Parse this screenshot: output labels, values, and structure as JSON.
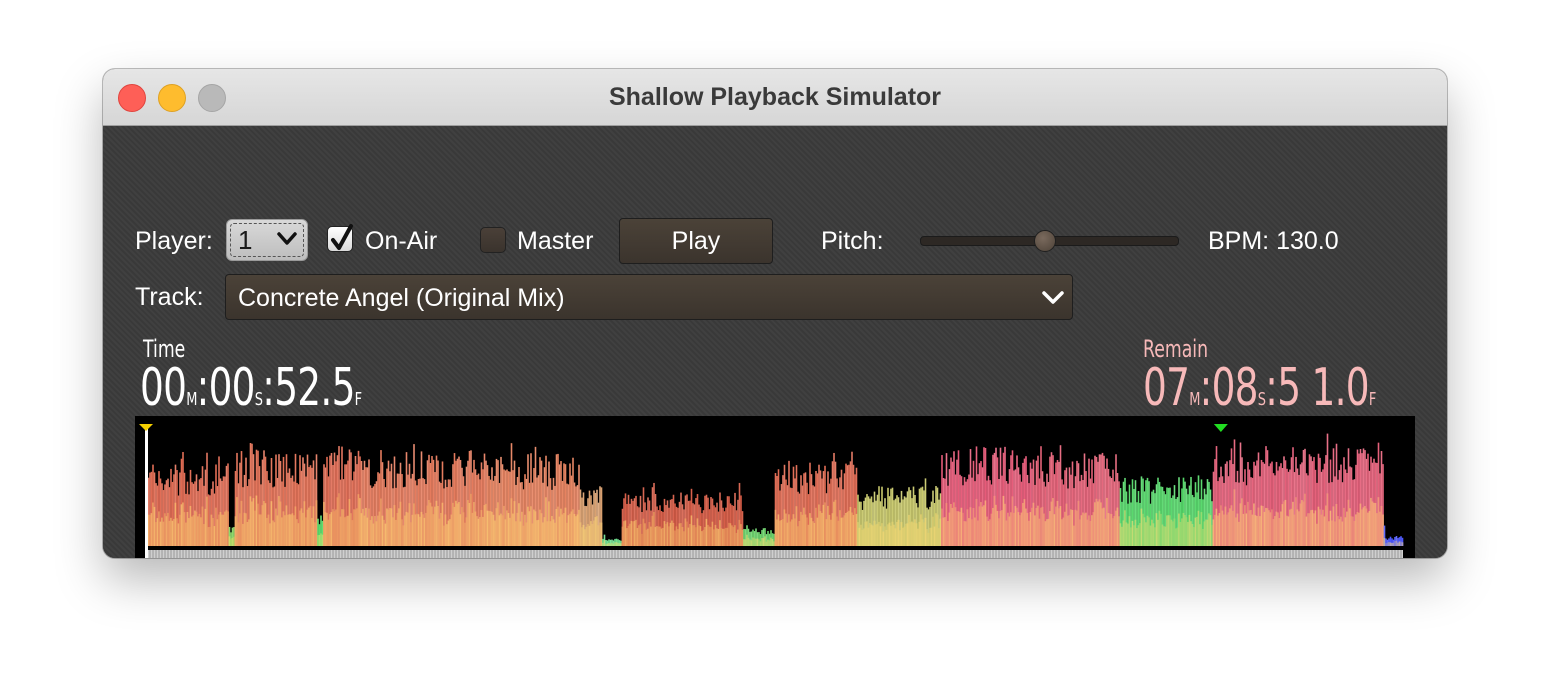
{
  "window": {
    "title": "Shallow Playback Simulator"
  },
  "controls": {
    "player_label": "Player:",
    "player_value": "1",
    "on_air_label": "On-Air",
    "on_air_checked": true,
    "master_label": "Master",
    "master_checked": false,
    "play_label": "Play",
    "pitch_label": "Pitch:",
    "pitch_level": 0.48,
    "bpm_text": "BPM: 130.0",
    "track_label": "Track:",
    "track_value": "Concrete Angel (Original Mix)"
  },
  "time_display": {
    "label": "Time",
    "minutes": "00",
    "m_unit": "M",
    "seconds": "00",
    "s_unit": "S",
    "frames": "52.5",
    "f_unit": "F"
  },
  "remain_display": {
    "label": "Remain",
    "minutes": "07",
    "m_unit": "M",
    "seconds": "08",
    "s_unit": "S",
    "frames": "5 1.0",
    "f_unit": "F"
  },
  "waveform": {
    "playhead_position": 0.0,
    "cue_marker_position": 0.855,
    "minute_ticks": 7,
    "colors": {
      "playhead": "#ffffff",
      "playhead_marker": "#f5d000",
      "cue_marker": "#22dd22"
    }
  }
}
